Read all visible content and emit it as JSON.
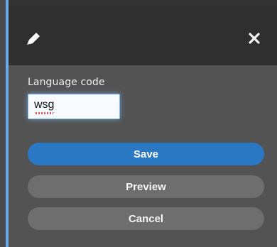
{
  "dialog": {
    "icons": {
      "edit": "pencil-icon",
      "close": "close-icon"
    },
    "language_code": {
      "label": "Language code",
      "value": "wsg"
    },
    "buttons": {
      "save": "Save",
      "preview": "Preview",
      "cancel": "Cancel"
    },
    "colors": {
      "accent": "#2a78c4",
      "secondary": "#6e6e6e",
      "focus_border": "#7ab9f0"
    }
  }
}
